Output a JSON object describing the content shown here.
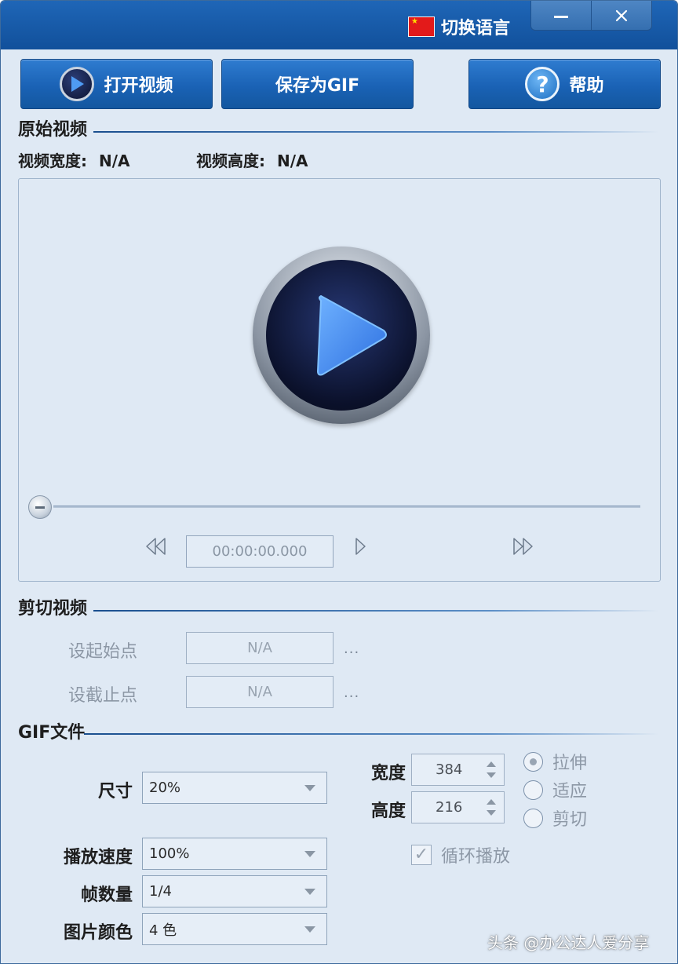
{
  "titlebar": {
    "lang_label": "切换语言",
    "flag_icon": "china-flag-icon",
    "minimize_icon": "minimize-icon",
    "close_icon": "close-icon"
  },
  "toolbar": {
    "open_label": "打开视频",
    "save_gif_label": "保存为GIF",
    "help_label": "帮助",
    "help_glyph": "?"
  },
  "source": {
    "section_title": "原始视频",
    "width_label": "视频宽度:",
    "width_value": "N/A",
    "height_label": "视频高度:",
    "height_value": "N/A",
    "time": "00:00:00.000",
    "progress": 0
  },
  "cut": {
    "section_title": "剪切视频",
    "start_label": "设起始点",
    "start_value": "N/A",
    "end_label": "设截止点",
    "end_value": "N/A",
    "browse_label": "..."
  },
  "gif": {
    "section_title": "GIF文件",
    "size_label": "尺寸",
    "size_value": "20%",
    "speed_label": "播放速度",
    "speed_value": "100%",
    "frames_label": "帧数量",
    "frames_value": "1/4",
    "color_label": "图片颜色",
    "color_value": "4 色",
    "width_label": "宽度",
    "width_value": "384",
    "height_label": "高度",
    "height_value": "216",
    "modes": [
      "拉伸",
      "适应",
      "剪切"
    ],
    "selected_mode": "拉伸",
    "loop_label": "循环播放",
    "loop_checked": true,
    "checkmark": "✓"
  },
  "watermark": "头条 @办公达人爱分享",
  "colors": {
    "window_bg": "#dfe9f4",
    "titlebar": "#1a5dab",
    "button": "#1d64b6",
    "accent_line": "#1a4f8f"
  }
}
